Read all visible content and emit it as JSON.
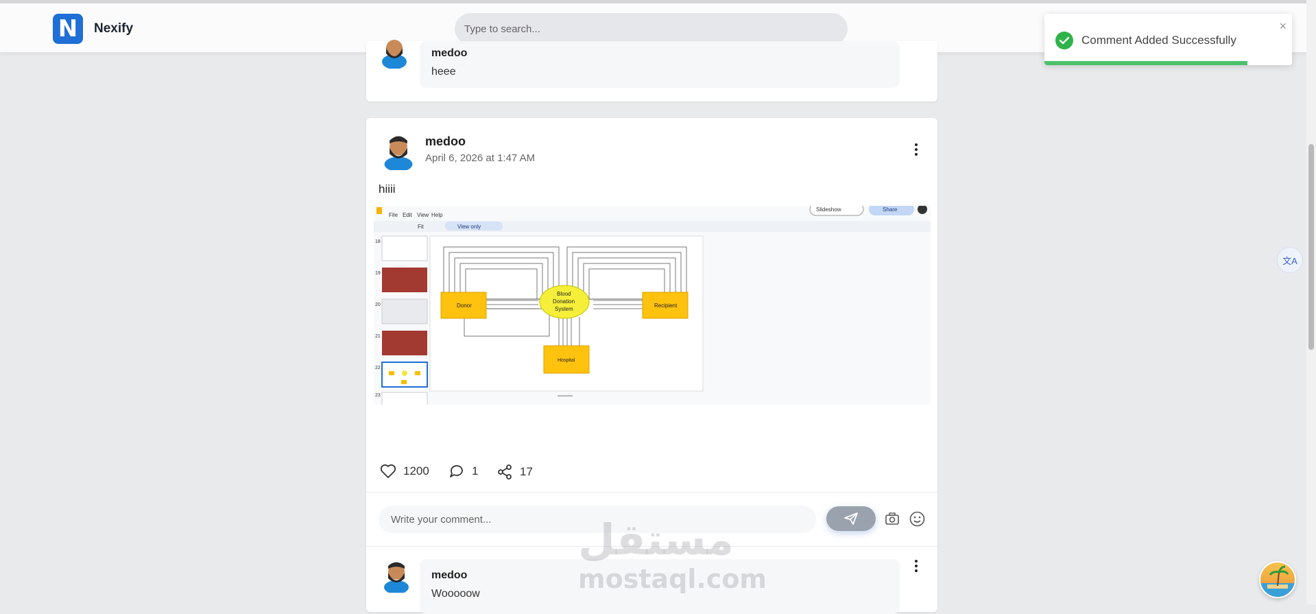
{
  "app": {
    "name": "Nexify",
    "logo_letter": "N",
    "accent": "#1f6fd6"
  },
  "search": {
    "placeholder": "Type to search..."
  },
  "toast": {
    "message": "Comment Added Successfully",
    "close": "×",
    "progress": 0.82,
    "color": "#2eb34a"
  },
  "previous_comment": {
    "author": "medoo",
    "text": "heee"
  },
  "post": {
    "author": "medoo",
    "date": "April 6, 2026 at 1:47 AM",
    "body": "hiiii",
    "likes": "1200",
    "comments": "1",
    "shares": "17"
  },
  "screenshot": {
    "menu": [
      "File",
      "Edit",
      "View",
      "Help"
    ],
    "zoom": "Fit",
    "view_mode": "View only",
    "slideshow": "Slideshow",
    "share": "Share",
    "slide_numbers": [
      "18",
      "19",
      "20",
      "21",
      "22",
      "23"
    ],
    "diagram": {
      "donor": "Donor",
      "system_lines": [
        "Blood",
        "Donation",
        "System"
      ],
      "recipient": "Recipient",
      "hospital": "Hospital"
    }
  },
  "comment_box": {
    "placeholder": "Write your comment..."
  },
  "first_comment": {
    "author": "medoo",
    "text": "Wooooow"
  },
  "watermark": {
    "arabic": "مستقل",
    "latin": "mostaql.com"
  },
  "translate": {
    "label": "文A"
  }
}
